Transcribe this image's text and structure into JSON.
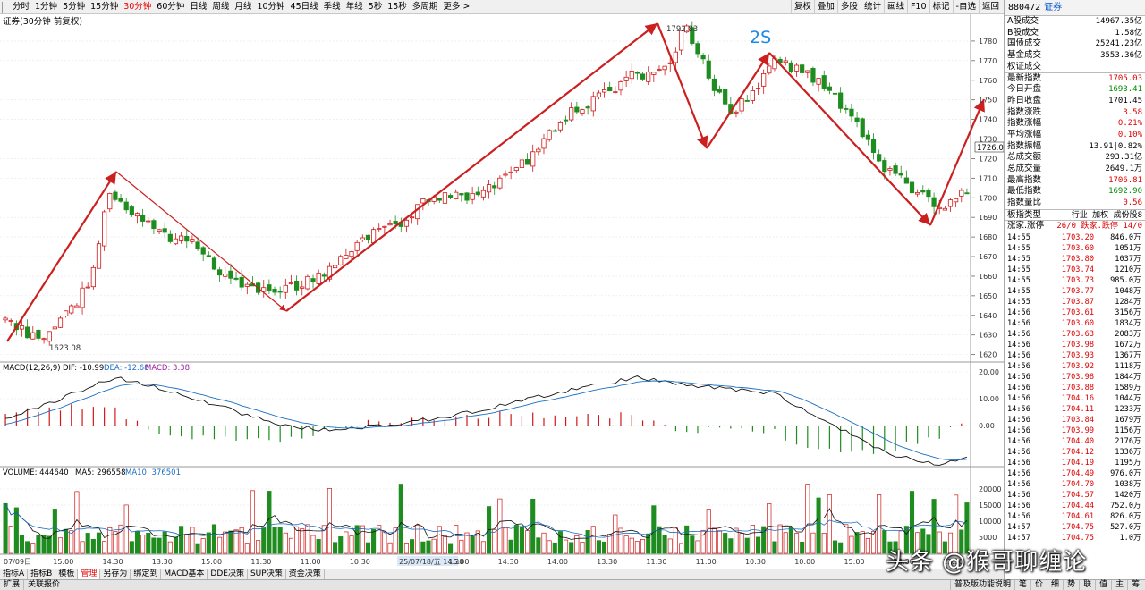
{
  "toolbar": {
    "periods": [
      "分时",
      "1分钟",
      "5分钟",
      "15分钟",
      "30分钟",
      "60分钟",
      "日线",
      "周线",
      "月线",
      "10分钟",
      "45日线",
      "季线",
      "年线",
      "5秒",
      "15秒",
      "多周期",
      "更多 >"
    ],
    "active_period": "30分钟",
    "right_buttons": [
      "复权",
      "叠加",
      "多股",
      "统计",
      "画线",
      "F10",
      "标记",
      "-自选",
      "返回"
    ]
  },
  "chart": {
    "title": "证券(30分钟 前复权)",
    "high_label": "1792.83",
    "low_label": "1623.08",
    "annotation": "2S",
    "current_price_tag": "1726.0",
    "y_ticks": [
      "1780",
      "1770",
      "1760",
      "1750",
      "1740",
      "1730",
      "1720",
      "1710",
      "1700",
      "1690",
      "1680",
      "1670",
      "1660",
      "1650",
      "1640",
      "1630",
      "1620"
    ],
    "colors": {
      "up": "#d01818",
      "down": "#1e8c1e",
      "arrow": "#cc1f1f",
      "annotation": "#1e88e5"
    }
  },
  "macd": {
    "label": "MACD(12,26,9)",
    "dif": "DIF: -10.99",
    "dea": "DEA: -12.68",
    "macd": "MACD: 3.38",
    "y_ticks": [
      "20.00",
      "10.00",
      "0.00"
    ]
  },
  "volume": {
    "label": "VOLUME: 444640",
    "ma5": "MA5: 296558",
    "ma10": "MA10: 376501",
    "y_ticks": [
      "20000",
      "15000",
      "10000",
      "5000"
    ]
  },
  "x_axis": {
    "labels": [
      "07/09日",
      "15:00",
      "14:30",
      "13:30",
      "15:00",
      "11:30",
      "11:00",
      "10:30",
      "25/07/18/五 14:30",
      "15:00",
      "14:30",
      "14:00",
      "13:30",
      "11:30",
      "11:00",
      "10:30",
      "10:00",
      "15:00",
      "14:30",
      "13:30"
    ]
  },
  "bottom_tabs": [
    "指标A",
    "指标B",
    "模板",
    "管理",
    "另存为",
    "绑定到",
    "MACD基本",
    "DDE决策",
    "SUP决策",
    "资金决策"
  ],
  "active_bottom_tab": "管理",
  "statusbar": {
    "left": [
      "扩展",
      "关联报价"
    ],
    "right": [
      "普及版功能说明",
      "笔",
      "价",
      "细",
      "势",
      "联",
      "值",
      "主",
      "筹"
    ]
  },
  "quote_panel": {
    "code": "880472",
    "name": "证券",
    "rows": [
      {
        "k": "A股成交",
        "v": "14967.35亿",
        "c": ""
      },
      {
        "k": "B股成交",
        "v": "1.58亿",
        "c": ""
      },
      {
        "k": "国债成交",
        "v": "25241.23亿",
        "c": ""
      },
      {
        "k": "基金成交",
        "v": "3553.36亿",
        "c": ""
      },
      {
        "k": "权证成交",
        "v": "",
        "c": ""
      },
      {
        "k": "最新指数",
        "v": "1705.03",
        "c": "red",
        "sep": true
      },
      {
        "k": "今日开盘",
        "v": "1693.41",
        "c": "green"
      },
      {
        "k": "昨日收盘",
        "v": "1701.45",
        "c": ""
      },
      {
        "k": "指数涨跌",
        "v": "3.58",
        "c": "red"
      },
      {
        "k": "指数涨幅",
        "v": "0.21%",
        "c": "red"
      },
      {
        "k": "平均涨幅",
        "v": "0.10%",
        "c": "red"
      },
      {
        "k": "指数振幅",
        "v": "13.91|0.82%",
        "c": ""
      },
      {
        "k": "总成交额",
        "v": "293.31亿",
        "c": ""
      },
      {
        "k": "总成交量",
        "v": "2649.1万",
        "c": ""
      },
      {
        "k": "最高指数",
        "v": "1706.81",
        "c": "red"
      },
      {
        "k": "最低指数",
        "v": "1692.90",
        "c": "green"
      },
      {
        "k": "指数量比",
        "v": "0.56",
        "c": "red"
      },
      {
        "k": "板指类型",
        "v": "行业 加权 成份股8",
        "c": "",
        "sep": true
      },
      {
        "k": "涨家.涨停",
        "v": "26/0 跌家.跌停  14/0",
        "c": "red",
        "sep": true
      }
    ],
    "trades": [
      [
        "14:55",
        "1703.20",
        "846.0"
      ],
      [
        "14:55",
        "1703.60",
        "1051"
      ],
      [
        "14:55",
        "1703.80",
        "1037"
      ],
      [
        "14:55",
        "1703.74",
        "1210"
      ],
      [
        "14:55",
        "1703.73",
        "985.0"
      ],
      [
        "14:55",
        "1703.77",
        "1048"
      ],
      [
        "14:55",
        "1703.87",
        "1284"
      ],
      [
        "14:56",
        "1703.61",
        "3156"
      ],
      [
        "14:56",
        "1703.60",
        "1834"
      ],
      [
        "14:56",
        "1703.63",
        "2083"
      ],
      [
        "14:56",
        "1703.98",
        "1672"
      ],
      [
        "14:56",
        "1703.93",
        "1367"
      ],
      [
        "14:56",
        "1703.92",
        "1118"
      ],
      [
        "14:56",
        "1703.98",
        "1844"
      ],
      [
        "14:56",
        "1703.88",
        "1589"
      ],
      [
        "14:56",
        "1704.16",
        "1044"
      ],
      [
        "14:56",
        "1704.11",
        "1233"
      ],
      [
        "14:56",
        "1703.84",
        "1679"
      ],
      [
        "14:56",
        "1703.99",
        "1156"
      ],
      [
        "14:56",
        "1704.40",
        "2176"
      ],
      [
        "14:56",
        "1704.12",
        "1336"
      ],
      [
        "14:56",
        "1704.19",
        "1195"
      ],
      [
        "14:56",
        "1704.49",
        "976.0"
      ],
      [
        "14:56",
        "1704.70",
        "1038"
      ],
      [
        "14:56",
        "1704.57",
        "1420"
      ],
      [
        "14:56",
        "1704.44",
        "752.0"
      ],
      [
        "14:56",
        "1704.61",
        "826.0"
      ],
      [
        "14:57",
        "1704.75",
        "527.0"
      ],
      [
        "14:57",
        "1704.75",
        "1.0"
      ]
    ],
    "trade_unit": "万"
  },
  "watermark": "头条 @猴哥聊缠论"
}
